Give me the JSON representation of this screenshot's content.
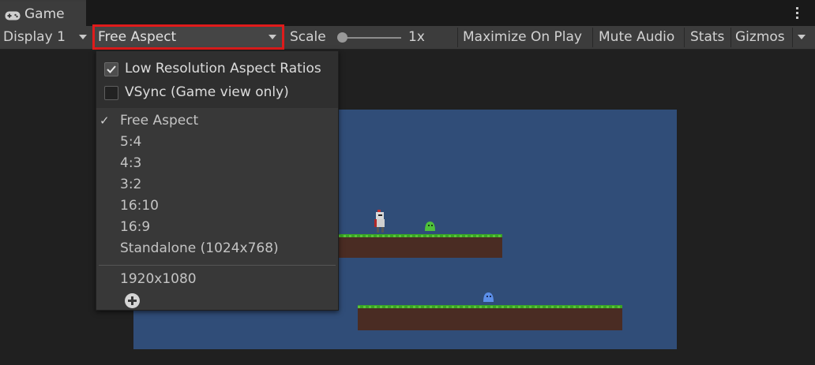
{
  "tab": {
    "label": "Game",
    "icon": "gamepad-icon"
  },
  "toolbar": {
    "display_label": "Display 1",
    "aspect_label": "Free Aspect",
    "scale_label": "Scale",
    "scale_value": "1x",
    "scale_level": 0.0,
    "maximize_label": "Maximize On Play",
    "mute_label": "Mute Audio",
    "stats_label": "Stats",
    "gizmos_label": "Gizmos"
  },
  "dropdown": {
    "low_res": {
      "label": "Low Resolution Aspect Ratios",
      "checked": true
    },
    "vsync": {
      "label": "VSync (Game view only)",
      "checked": false
    },
    "options": [
      "Free Aspect",
      "5:4",
      "4:3",
      "3:2",
      "16:10",
      "16:9",
      "Standalone (1024x768)"
    ],
    "selected": "Free Aspect",
    "selected_mark": "✓",
    "custom": [
      "1920x1080"
    ]
  },
  "colors": {
    "highlight_border": "#e01b1b",
    "game_background": "#304d78",
    "grass": "#3aa524",
    "dirt": "#4a2c23",
    "slime_green": "#4fc23a",
    "slime_blue": "#5b8ee8"
  }
}
